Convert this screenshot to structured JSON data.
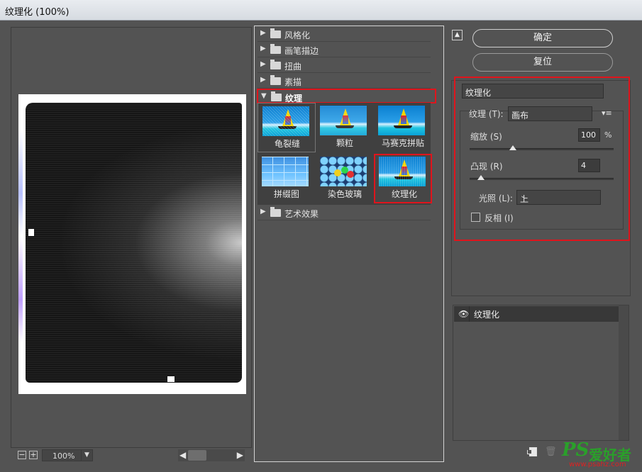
{
  "window": {
    "title": "纹理化 (100%)"
  },
  "preview": {
    "zoom": "100%",
    "zoom_out": "−",
    "zoom_in": "+"
  },
  "gallery": {
    "categories": [
      {
        "label": "风格化",
        "open": false
      },
      {
        "label": "画笔描边",
        "open": false
      },
      {
        "label": "扭曲",
        "open": false
      },
      {
        "label": "素描",
        "open": false
      },
      {
        "label": "纹理",
        "open": true
      },
      {
        "label": "艺术效果",
        "open": false
      }
    ],
    "texture_filters": [
      {
        "label": "龟裂缝"
      },
      {
        "label": "颗粒"
      },
      {
        "label": "马赛克拼贴"
      },
      {
        "label": "拼缀图"
      },
      {
        "label": "染色玻璃"
      },
      {
        "label": "纹理化",
        "selected": true
      }
    ]
  },
  "actions": {
    "ok": "确定",
    "reset": "复位"
  },
  "settings": {
    "filter_select": "纹理化",
    "texture_label": "纹理 (T):",
    "texture_value": "画布",
    "scaling_label": "缩放 (S)",
    "scaling_value": "100",
    "scaling_unit": "%",
    "scaling_fraction": 0.3,
    "relief_label": "凸现 (R)",
    "relief_value": "4",
    "relief_fraction": 0.08,
    "light_label": "光照 (L):",
    "light_value": "上",
    "invert_label": "反相 (I)",
    "invert_checked": false
  },
  "layers": {
    "items": [
      {
        "name": "纹理化",
        "visible": true
      }
    ]
  },
  "watermark": {
    "logo": "PS",
    "text": "爱好者",
    "url": "www.psahz.com"
  },
  "colors": {
    "highlight": "#e0141c",
    "background": "#535353"
  }
}
